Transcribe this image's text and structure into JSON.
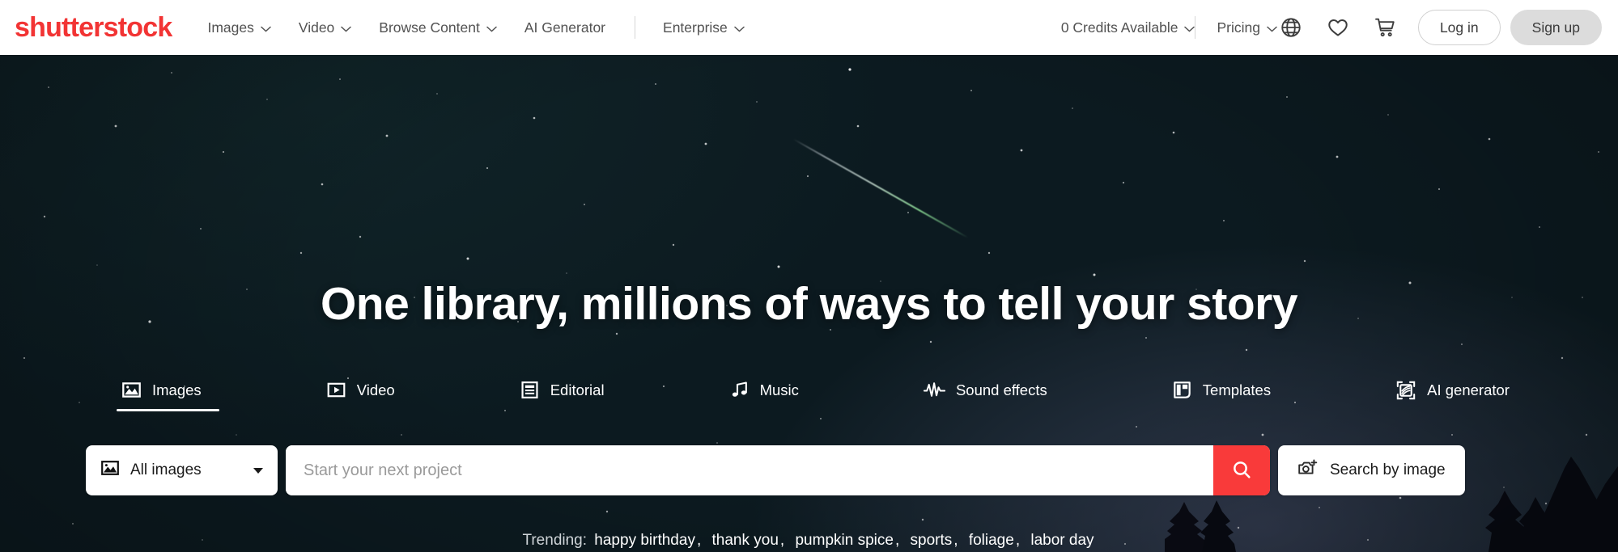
{
  "brand": {
    "logo_text": "shutterstock",
    "logo_color": "#f23434"
  },
  "header": {
    "nav": [
      {
        "label": "Images",
        "has_dropdown": true,
        "icon": "chevron-down-icon"
      },
      {
        "label": "Video",
        "has_dropdown": true,
        "icon": "chevron-down-icon"
      },
      {
        "label": "Browse Content",
        "has_dropdown": true,
        "icon": "chevron-down-icon"
      },
      {
        "label": "AI Generator",
        "has_dropdown": false
      },
      {
        "label": "Enterprise",
        "has_dropdown": true,
        "icon": "chevron-down-icon"
      }
    ],
    "credits_label": "0 Credits Available",
    "pricing_label": "Pricing",
    "icons": [
      {
        "name": "globe-icon",
        "label": "Language"
      },
      {
        "name": "heart-icon",
        "label": "Favorites"
      },
      {
        "name": "cart-icon",
        "label": "Cart"
      }
    ],
    "login_label": "Log in",
    "signup_label": "Sign up"
  },
  "hero": {
    "headline": "One library, millions of ways to tell your story",
    "background": "night-sky-with-meteor-and-pine-trees",
    "sky_color": "#0e2027"
  },
  "tabs": {
    "active": "Images",
    "items": [
      {
        "label": "Images",
        "icon": "image-icon",
        "active": true
      },
      {
        "label": "Video",
        "icon": "video-play-icon",
        "active": false
      },
      {
        "label": "Editorial",
        "icon": "editorial-icon",
        "active": false
      },
      {
        "label": "Music",
        "icon": "music-note-icon",
        "active": false
      },
      {
        "label": "Sound effects",
        "icon": "waveform-icon",
        "active": false
      },
      {
        "label": "Templates",
        "icon": "templates-icon",
        "active": false
      },
      {
        "label": "AI generator",
        "icon": "ai-generator-icon",
        "active": false
      }
    ]
  },
  "search": {
    "category_label": "All images",
    "category_icon": "image-icon",
    "caret_icon": "caret-down-icon",
    "placeholder": "Start your next project",
    "value": "",
    "search_icon": "search-icon",
    "search_button_color": "#f93a3a",
    "by_image_label": "Search by image",
    "by_image_icon": "camera-plus-icon"
  },
  "trending": {
    "label": "Trending:",
    "terms": [
      "happy birthday",
      "thank you",
      "pumpkin spice",
      "sports",
      "foliage",
      "labor day"
    ]
  }
}
